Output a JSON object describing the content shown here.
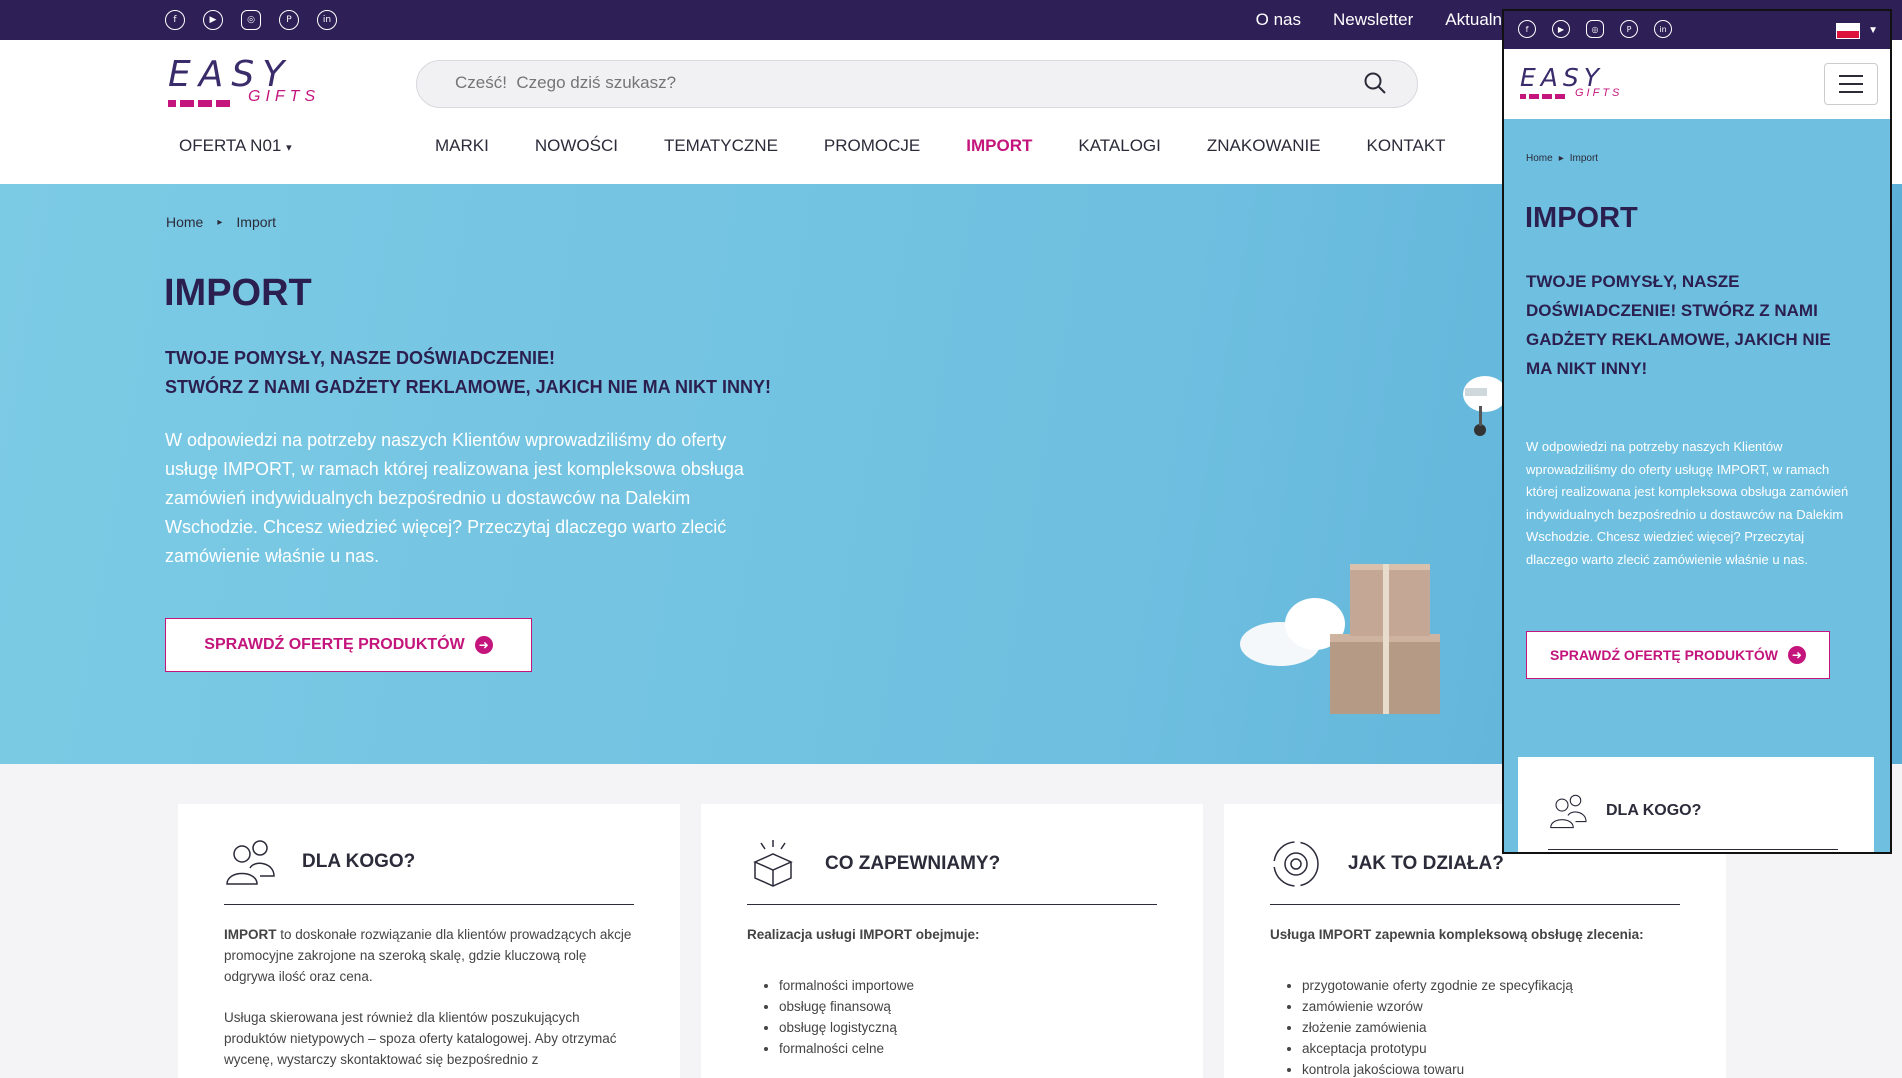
{
  "topbar": {
    "social_icons": [
      "facebook-icon",
      "youtube-icon",
      "instagram-icon",
      "pinterest-icon",
      "linkedin-icon"
    ],
    "links": [
      "O nas",
      "Newsletter",
      "Aktualn"
    ]
  },
  "header": {
    "logo": {
      "easy": "EASY",
      "gifts": "GIFTS"
    },
    "search_placeholder": "Cześć!  Czego dziś szukasz?",
    "offer_menu": "OFERTA N01",
    "nav": [
      "MARKI",
      "NOWOŚCI",
      "TEMATYCZNE",
      "PROMOCJE",
      "IMPORT",
      "KATALOGI",
      "ZNAKOWANIE",
      "KONTAKT"
    ],
    "active_nav": "IMPORT"
  },
  "hero": {
    "breadcrumb": [
      "Home",
      "Import"
    ],
    "title": "IMPORT",
    "tagline_1": "TWOJE POMYSŁY, NASZE DOŚWIADCZENIE!",
    "tagline_2": "STWÓRZ Z NAMI GADŻETY REKLAMOWE, JAKICH NIE MA NIKT INNY!",
    "description": "W odpowiedzi na potrzeby naszych Klientów wprowadziliśmy do oferty usługę IMPORT, w ramach której realizowana jest kompleksowa obsługa zamówień indywidualnych bezpośrednio u dostawców na Dalekim Wschodzie. Chcesz wiedzieć więcej? Przeczytaj dlaczego warto zlecić zamówienie właśnie u nas.",
    "cta": "SPRAWDŹ OFERTĘ PRODUKTÓW"
  },
  "cards": [
    {
      "title": "DLA KOGO?",
      "icon": "people-icon",
      "bold": "IMPORT",
      "p1": " to doskonałe rozwiązanie dla klientów prowadzących akcje promocyjne zakrojone na szeroką skalę, gdzie kluczową rolę odgrywa ilość oraz cena.",
      "p2": "Usługa skierowana jest również dla klientów poszukujących produktów nietypowych – spoza oferty katalogowej. Aby otrzymać wycenę, wystarczy skontaktować się bezpośrednio z"
    },
    {
      "title": "CO ZAPEWNIAMY?",
      "icon": "open-box-icon",
      "intro": "Realizacja usługi IMPORT obejmuje:",
      "items": [
        "formalności importowe",
        "obsługę finansową",
        "obsługę logistyczną",
        "formalności celne"
      ]
    },
    {
      "title": "JAK TO DZIAŁA?",
      "icon": "gear-cycle-icon",
      "intro": "Usługa IMPORT zapewnia kompleksową obsługę zlecenia:",
      "items": [
        "przygotowanie oferty zgodnie ze specyfikacją",
        "zamówienie wzorów",
        "złożenie zamówienia",
        "akceptacja prototypu",
        "kontrola jakościowa towaru"
      ]
    }
  ],
  "mobile": {
    "breadcrumb": [
      "Home",
      "Import"
    ],
    "title": "IMPORT",
    "tagline": "TWOJE POMYSŁY, NASZE DOŚWIADCZENIE! STWÓRZ Z NAMI GADŻETY REKLAMOWE, JAKICH NIE MA NIKT INNY!",
    "description": "W odpowiedzi na potrzeby naszych Klientów wprowadziliśmy do oferty usługę IMPORT, w ramach której realizowana jest kompleksowa obsługa zamówień indywidualnych bezpośrednio u dostawców na Dalekim Wschodzie. Chcesz wiedzieć więcej? Przeczytaj dlaczego warto zlecić zamówienie właśnie u nas.",
    "cta": "SPRAWDŹ OFERTĘ PRODUKTÓW",
    "card_title": "DLA KOGO?"
  },
  "colors": {
    "topbar": "#2e1f57",
    "accent": "#c3157c",
    "hero": "#6ebfe0",
    "heading": "#2b1f4f"
  }
}
